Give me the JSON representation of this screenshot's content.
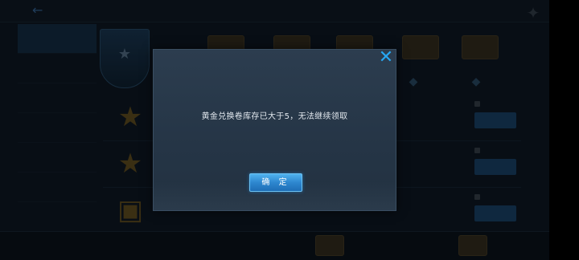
{
  "dialog": {
    "message": "黄金兑换卷库存已大于5，无法继续领取",
    "confirm_label": "确 定",
    "close_icon": "close-icon"
  },
  "colors": {
    "accent": "#27a7f2",
    "button": "#2e87cf",
    "dialog_bg": "#2c3d4f"
  }
}
